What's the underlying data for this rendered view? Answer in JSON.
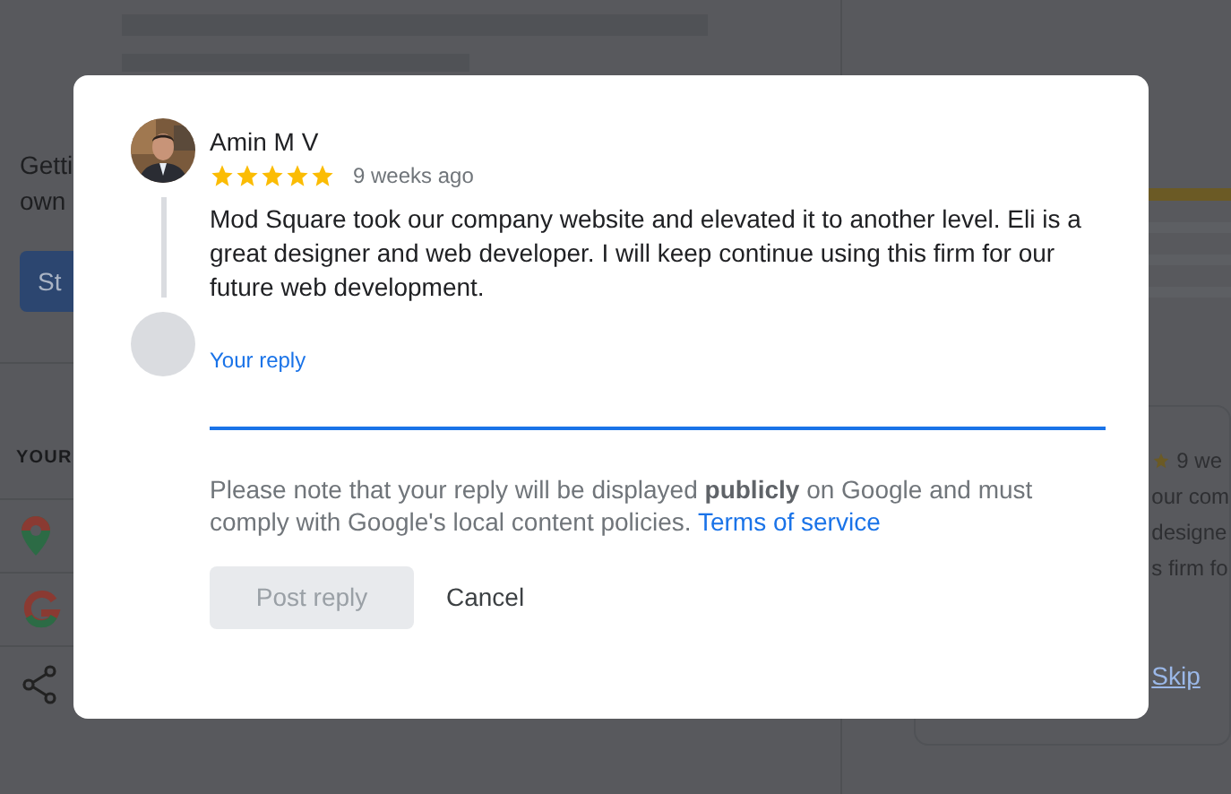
{
  "background": {
    "left": {
      "lines": [
        "Getti",
        "own"
      ],
      "button": "St",
      "section_heading": "YOUR"
    },
    "right": {
      "time": "9 we",
      "review_lines": [
        "our com",
        "designe",
        "s firm fo"
      ],
      "link": "Skip"
    }
  },
  "dialog": {
    "review": {
      "author": "Amin M V",
      "stars": 5,
      "time": "9 weeks ago",
      "text": "Mod Square took our company website and elevated it to another level. Eli is a great designer and web developer. I will keep continue using this firm for our future web development."
    },
    "reply": {
      "label": "Your reply",
      "focused": true
    },
    "note": {
      "text": "Please note that your reply will be displayed **publicly** on Google and must comply with Google's local content policies.",
      "link": "Terms of service"
    },
    "buttons": [
      {
        "label": "Post reply",
        "kind": "filled",
        "disabled": true
      },
      {
        "label": "Cancel",
        "kind": "text",
        "disabled": false
      }
    ]
  }
}
